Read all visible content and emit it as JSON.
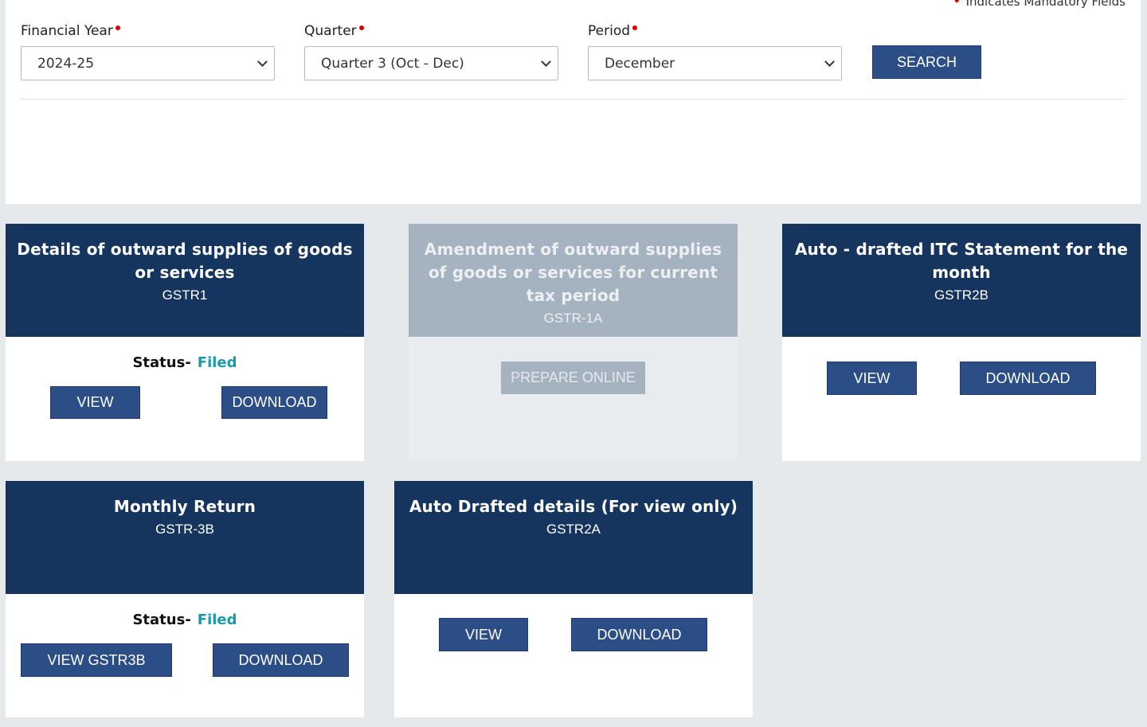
{
  "mandatory_note": "Indicates Mandatory Fields",
  "filters": {
    "financial_year": {
      "label": "Financial Year",
      "value": "2024-25"
    },
    "quarter": {
      "label": "Quarter",
      "value": "Quarter 3 (Oct - Dec)"
    },
    "period": {
      "label": "Period",
      "value": "December"
    },
    "search_label": "SEARCH"
  },
  "tiles": {
    "gstr1": {
      "title": "Details of outward supplies of goods or services",
      "code": "GSTR1",
      "status_label": "Status-",
      "status_value": "Filed",
      "view_label": "VIEW",
      "download_label": "DOWNLOAD"
    },
    "gstr1a": {
      "title": "Amendment of outward supplies of goods or services for current tax period",
      "code": "GSTR-1A",
      "prepare_label": "PREPARE ONLINE"
    },
    "gstr2b": {
      "title": "Auto - drafted ITC Statement for the month",
      "code": "GSTR2B",
      "view_label": "VIEW",
      "download_label": "DOWNLOAD"
    },
    "gstr3b": {
      "title": "Monthly Return",
      "code": "GSTR-3B",
      "status_label": "Status-",
      "status_value": "Filed",
      "view_label": "VIEW GSTR3B",
      "download_label": "DOWNLOAD"
    },
    "gstr2a": {
      "title": "Auto Drafted details (For view only)",
      "code": "GSTR2A",
      "view_label": "VIEW",
      "download_label": "DOWNLOAD"
    }
  },
  "colors": {
    "navy": "#15355e",
    "button": "#2c4e86",
    "filed": "#1a9aa8",
    "disabled": "#a5b2bf",
    "required": "#e00000"
  }
}
